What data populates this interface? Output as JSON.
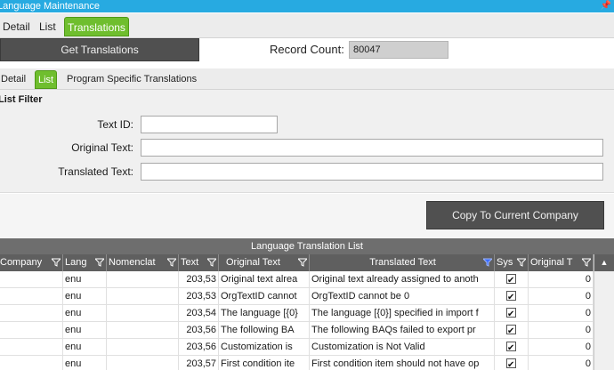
{
  "window": {
    "title": "Language Maintenance",
    "pin_glyph": "📌"
  },
  "top_tabs": [
    {
      "label": "Detail"
    },
    {
      "label": "List"
    },
    {
      "label": "Translations"
    }
  ],
  "toolbar": {
    "get_translations_label": "Get Translations",
    "record_count_label": "Record Count:",
    "record_count_value": "80047"
  },
  "sub_tabs": [
    {
      "label": "Detail"
    },
    {
      "label": "List"
    },
    {
      "label": "Program Specific Translations"
    }
  ],
  "filter": {
    "title": "List Filter",
    "fields": [
      {
        "label": "Text ID:",
        "value": ""
      },
      {
        "label": "Original Text:",
        "value": ""
      },
      {
        "label": "Translated Text:",
        "value": ""
      }
    ]
  },
  "copy_button_label": "Copy To Current Company",
  "grid": {
    "caption": "Language Translation List",
    "columns": [
      "Company",
      "Lang",
      "Nomenclat",
      "Text",
      "Original Text",
      "Translated Text",
      "Sys",
      "Original T"
    ],
    "rows": [
      {
        "company": "",
        "lang": "enu",
        "nomen": "",
        "text": "203,53",
        "orig": "Original text alrea",
        "trans": "Original text already assigned to anoth",
        "sys": true,
        "origt": "0"
      },
      {
        "company": "",
        "lang": "enu",
        "nomen": "",
        "text": "203,53",
        "orig": "OrgTextID cannot",
        "trans": "OrgTextID cannot be 0",
        "sys": true,
        "origt": "0"
      },
      {
        "company": "",
        "lang": "enu",
        "nomen": "",
        "text": "203,54",
        "orig": "The language [{0}",
        "trans": "The language [{0}] specified in import f",
        "sys": true,
        "origt": "0"
      },
      {
        "company": "",
        "lang": "enu",
        "nomen": "",
        "text": "203,56",
        "orig": "The following BA",
        "trans": "The following BAQs failed to export pr",
        "sys": true,
        "origt": "0"
      },
      {
        "company": "",
        "lang": "enu",
        "nomen": "",
        "text": "203,56",
        "orig": "Customization is",
        "trans": "Customization is Not Valid",
        "sys": true,
        "origt": "0"
      },
      {
        "company": "",
        "lang": "enu",
        "nomen": "",
        "text": "203,57",
        "orig": "First condition ite",
        "trans": "First condition item should not have op",
        "sys": true,
        "origt": "0"
      }
    ]
  },
  "colors": {
    "accent_blue": "#27aae1",
    "tab_green": "#6fbe2e",
    "dark_button": "#505050",
    "header_gray": "#5f5f5f"
  }
}
